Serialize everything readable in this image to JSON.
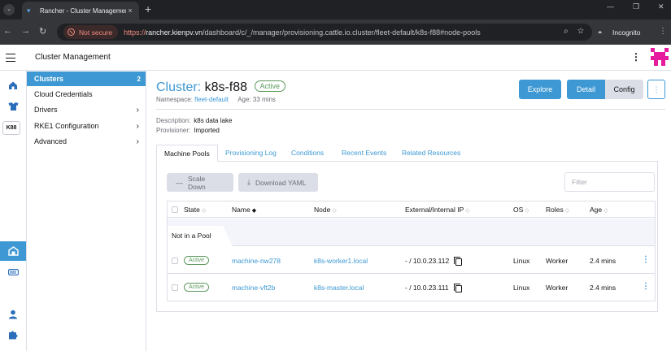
{
  "browser": {
    "tab_title": "Rancher - Cluster Management",
    "tab_close": "×",
    "new_tab": "+",
    "security_chip": "Not secure",
    "url_scheme": "https://",
    "url_host": "rancher.kienpv.vn",
    "url_path": "/dashboard/c/_/manager/provisioning.cattle.io.cluster/fleet-default/k8s-f88#node-pools",
    "incognito_label": "Incognito"
  },
  "header": {
    "title": "Cluster Management"
  },
  "rail": {
    "cluster_badge": "K88"
  },
  "sidebar": {
    "items": [
      {
        "label": "Clusters",
        "count": "2"
      },
      {
        "label": "Cloud Credentials"
      },
      {
        "label": "Drivers"
      },
      {
        "label": "RKE1 Configuration"
      },
      {
        "label": "Advanced"
      }
    ]
  },
  "cluster": {
    "prefix": "Cluster:",
    "name": "k8s-f88",
    "status": "Active",
    "namespace_label": "Namespace:",
    "namespace": "fleet-default",
    "age": "Age: 33 mins",
    "description_label": "Description:",
    "description": "k8s data lake",
    "provisioner_label": "Provisioner:",
    "provisioner": "Imported"
  },
  "actions": {
    "explore": "Explore",
    "detail": "Detail",
    "config": "Config"
  },
  "tabs": [
    "Machine Pools",
    "Provisioning Log",
    "Conditions",
    "Recent Events",
    "Related Resources"
  ],
  "toolbar": {
    "scale_down": "Scale Down",
    "download_yaml": "Download YAML",
    "filter_placeholder": "Filter"
  },
  "table": {
    "columns": [
      "State",
      "Name",
      "Node",
      "External/Internal IP",
      "OS",
      "Roles",
      "Age"
    ],
    "group_label": "Not in a Pool",
    "rows": [
      {
        "state": "Active",
        "name": "machine-nw278",
        "node": "k8s-worker1.local",
        "ip": "- / 10.0.23.112",
        "os": "Linux",
        "roles": "Worker",
        "age": "2.4 mins"
      },
      {
        "state": "Active",
        "name": "machine-vft2b",
        "node": "k8s-master.local",
        "ip": "- / 10.0.23.111",
        "os": "Linux",
        "roles": "Worker",
        "age": "2.4 mins"
      }
    ]
  },
  "colors": {
    "accent": "#3d98d3",
    "active_status": "#5d995d",
    "avatar": "#e61a9c"
  }
}
